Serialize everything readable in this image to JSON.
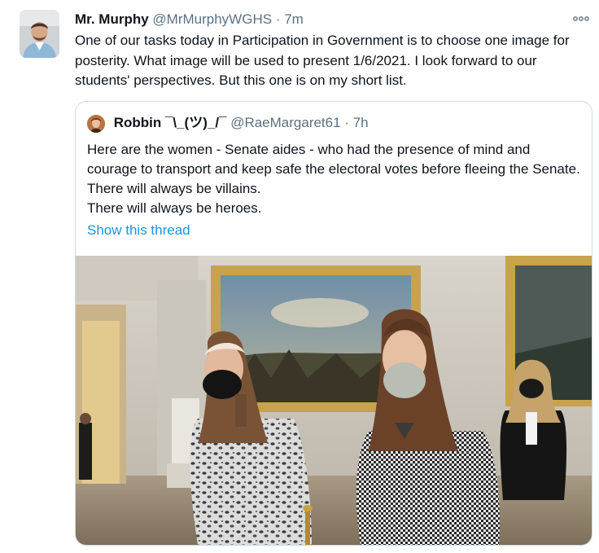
{
  "tweet": {
    "author_name": "Mr. Murphy",
    "author_handle": "@MrMurphyWGHS",
    "separator": "·",
    "time": "7m",
    "text": "One of our tasks today in Participation in Government is to choose one image for posterity. What image will be used to present 1/6/2021. I look forward to our students' perspectives. But this one is on my short list.",
    "more_icon": "more-options-icon"
  },
  "quoted": {
    "author_name": "Robbin ¯\\_(ツ)_/¯",
    "author_handle": "@RaeMargaret61",
    "separator": "·",
    "time": "7h",
    "paragraphs": [
      "Here are the women - Senate aides - who had the presence of mind and courage to transport  and keep safe the electoral votes before fleeing the Senate. There will always be villains.",
      "There will always be heroes."
    ],
    "show_thread": "Show this thread"
  },
  "colors": {
    "accent": "#1b95e0",
    "secondary_text": "#5b7083",
    "border": "#cfd9de"
  }
}
